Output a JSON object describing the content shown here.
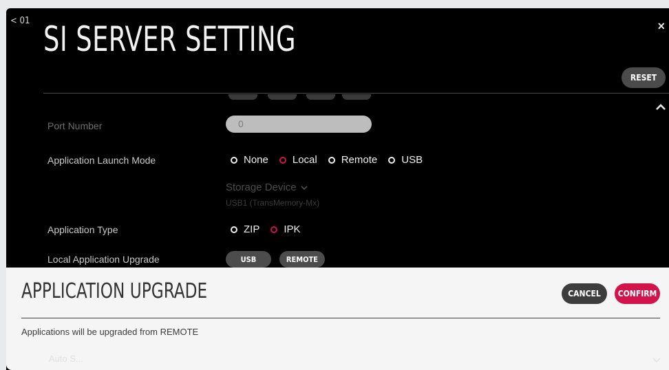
{
  "header": {
    "back_label": "< 01",
    "title": "SI SERVER SETTING",
    "close_glyph": "×",
    "reset_label": "RESET"
  },
  "settings": {
    "port_number": {
      "label": "Port Number",
      "value": "0"
    },
    "launch_mode": {
      "label": "Application Launch Mode",
      "options": [
        "None",
        "Local",
        "Remote",
        "USB"
      ],
      "selected": "Local"
    },
    "storage": {
      "title": "Storage Device",
      "value": "USB1 (TransMemory-Mx)"
    },
    "app_type": {
      "label": "Application Type",
      "options": [
        "ZIP",
        "IPK"
      ],
      "selected": "IPK"
    },
    "local_upgrade": {
      "label": "Local Application Upgrade",
      "usb_label": "USB",
      "remote_label": "REMOTE"
    }
  },
  "dialog": {
    "title": "APPLICATION UPGRADE",
    "cancel_label": "CANCEL",
    "confirm_label": "CONFIRM",
    "message": "Applications will be upgraded from REMOTE",
    "ghost_text": "Auto S..."
  },
  "colors": {
    "accent": "#d2134c",
    "background": "#000000",
    "dialog_bg": "#f5f5f5"
  }
}
